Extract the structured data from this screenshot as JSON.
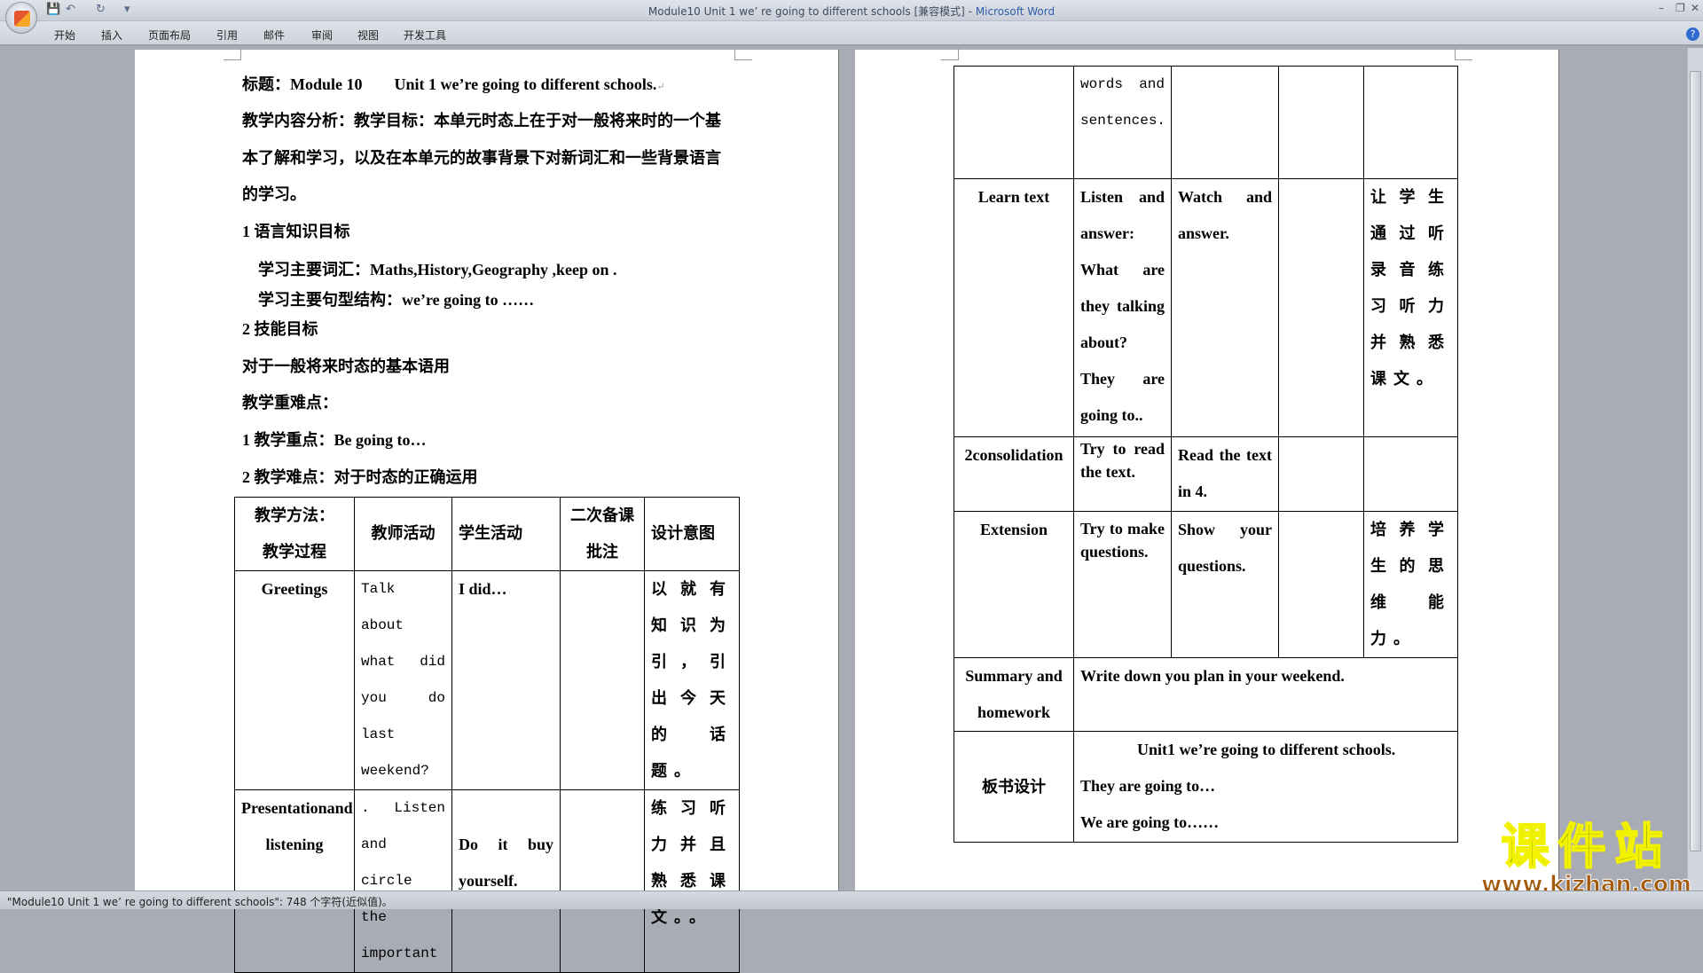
{
  "window": {
    "title": "Module10 Unit 1 we’ re going to different schools [兼容模式]",
    "app_name": "Microsoft Word",
    "minimize": "–",
    "restore": "❐",
    "close": "✕"
  },
  "quick_access": {
    "save_icon": "save-icon",
    "undo_icon": "undo-icon",
    "redo_icon": "redo-icon",
    "customize": "▾"
  },
  "ribbon": {
    "tabs": [
      "开始",
      "插入",
      "页面布局",
      "引用",
      "邮件",
      "审阅",
      "视图",
      "开发工具"
    ],
    "help": "?"
  },
  "left_page": {
    "title_label": "标题：",
    "title_module": "Module 10",
    "title_unit": "Unit 1 we’re going to different schools.",
    "para1": "教学内容分析：教学目标：本单元时态上在于对一般将来时的一个基",
    "para1_l2": "本了解和学习，以及在本单元的故事背景下对新词汇和一些背景语言",
    "para1_l3": "的学习。",
    "h1": "1  语言知识目标",
    "vocab": "学习主要词汇：Maths,History,Geography ,keep on .",
    "structure": "学习主要句型结构：we’re going to ……",
    "h2": "2  技能目标",
    "skill": "对于一般将来时态的基本语用",
    "key_title": "教学重难点：",
    "key1": "1  教学重点：Be going to…",
    "key2": "2  教学难点：对于时态的正确运用",
    "table": {
      "headers": [
        "教学方法：\n教学过程",
        "教师活动",
        "学生活动",
        "二次备课批注",
        "设计意图"
      ],
      "rows": [
        [
          "Greetings",
          "Talk about what did you do last weekend?",
          "I did…",
          "",
          "以就有知识为引，引出今天的话题。"
        ],
        [
          "Presentationand listening",
          ". Listen and circle the important",
          "Do it buy yourself.",
          "",
          "练习听力并且熟悉课文。。"
        ]
      ]
    }
  },
  "right_page": {
    "table": {
      "rows": [
        [
          "",
          "words and sentences.",
          "",
          "",
          ""
        ],
        [
          "Learn text",
          "Listen and answer: What are they talking about? They are going to..",
          "Watch and answer.",
          "",
          "让学生通过听录音练习听力并熟悉课文。"
        ],
        [
          "2consolidation",
          "Try to read the text.",
          "Read the text in 4.",
          "",
          ""
        ],
        [
          "Extension",
          "Try to make questions.",
          "Show your questions.",
          "",
          "培养学生的思维能力。"
        ],
        [
          "Summary and homework",
          "Write down you plan in your weekend."
        ],
        [
          "板书设计",
          "Unit1 we’re going to different schools.",
          "They are going to…",
          "We are going to……"
        ]
      ]
    }
  },
  "status_bar": {
    "text": "\"Module10 Unit 1 we’  re going to different schools\": 748 个字符(近似值)。"
  },
  "watermark": {
    "text": "课件站",
    "url": "www.kjzhan.com"
  }
}
